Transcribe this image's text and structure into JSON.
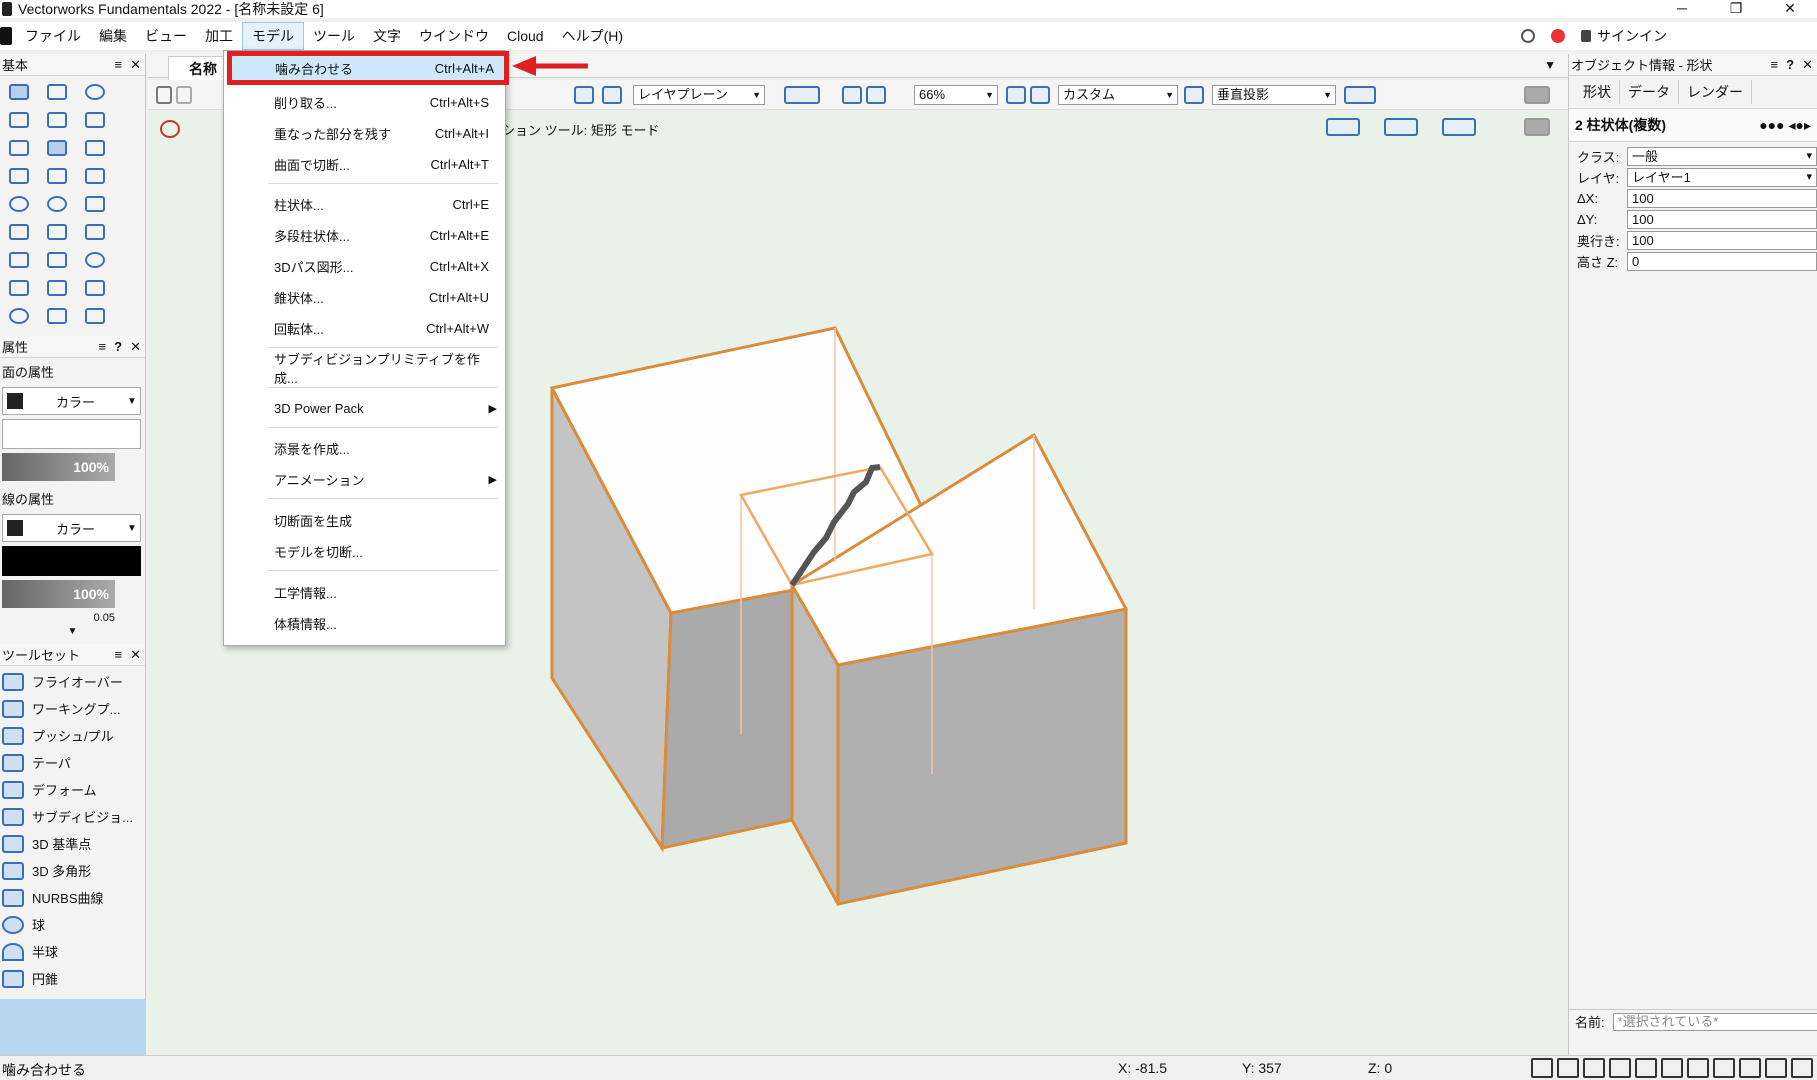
{
  "window": {
    "title": "Vectorworks Fundamentals 2022 - [名称未設定 6]",
    "buttons": [
      "─",
      "❐",
      "✕"
    ]
  },
  "menubar": {
    "items": [
      "ファイル",
      "編集",
      "ビュー",
      "加工",
      "モデル",
      "ツール",
      "文字",
      "ウインドウ",
      "Cloud",
      "ヘルプ(H)"
    ],
    "signin": "サインイン"
  },
  "left_panel": {
    "basic_title": "基本",
    "attr_title": "属性",
    "fill_label": "面の属性",
    "fill_color_label": "カラー",
    "fill_opacity": "100%",
    "line_label": "線の属性",
    "line_color_label": "カラー",
    "line_opacity": "100%",
    "line_thickness": "0.05",
    "toolset_title": "ツールセット",
    "toolset_items": [
      "フライオーバー",
      "ワーキングプ...",
      "プッシュ/プル",
      "テーパ",
      "デフォーム",
      "サブディビジョ...",
      "3D 基準点",
      "3D 多角形",
      "NURBS曲線",
      "球",
      "半球",
      "円錐"
    ]
  },
  "document": {
    "tab_label": "名称",
    "layer_select": "レイヤプレーン",
    "zoom": "66%",
    "render_mode": "カスタム",
    "projection": "垂直投影",
    "mode_text": "ション ツール: 矩形 モード"
  },
  "model_menu": {
    "items": [
      {
        "label": "噛み合わせる",
        "shortcut": "Ctrl+Alt+A"
      },
      {
        "label": "削り取る...",
        "shortcut": "Ctrl+Alt+S"
      },
      {
        "label": "重なった部分を残す",
        "shortcut": "Ctrl+Alt+I"
      },
      {
        "label": "曲面で切断...",
        "shortcut": "Ctrl+Alt+T"
      },
      {
        "label": "柱状体...",
        "shortcut": "Ctrl+E"
      },
      {
        "label": "多段柱状体...",
        "shortcut": "Ctrl+Alt+E"
      },
      {
        "label": "3Dパス図形...",
        "shortcut": "Ctrl+Alt+X"
      },
      {
        "label": "錐状体...",
        "shortcut": "Ctrl+Alt+U"
      },
      {
        "label": "回転体...",
        "shortcut": "Ctrl+Alt+W"
      },
      {
        "label": "サブディビジョンプリミティブを作成...",
        "shortcut": ""
      },
      {
        "label": "3D Power Pack",
        "shortcut": ""
      },
      {
        "label": "添景を作成...",
        "shortcut": ""
      },
      {
        "label": "アニメーション",
        "shortcut": ""
      },
      {
        "label": "切断面を生成",
        "shortcut": ""
      },
      {
        "label": "モデルを切断...",
        "shortcut": ""
      },
      {
        "label": "工学情報...",
        "shortcut": ""
      },
      {
        "label": "体積情報...",
        "shortcut": ""
      }
    ]
  },
  "obj_info": {
    "title": "オブジェクト情報 - 形状",
    "tabs": [
      "形状",
      "データ",
      "レンダー"
    ],
    "object_type": "2 柱状体(複数)",
    "fields": [
      {
        "key": "クラス:",
        "value": "一般"
      },
      {
        "key": "レイヤ:",
        "value": "レイヤー1"
      },
      {
        "key": "ΔX:",
        "value": "100"
      },
      {
        "key": "ΔY:",
        "value": "100"
      },
      {
        "key": "奥行き:",
        "value": "100"
      },
      {
        "key": "高さ Z:",
        "value": "0"
      }
    ],
    "name_label": "名前:",
    "name_value": "*選択されている*"
  },
  "status": {
    "message": "噛み合わせる",
    "x": "X: -81.5",
    "y": "Y: 357",
    "z": "Z: 0"
  },
  "colors": {
    "highlight_border": "#e02020",
    "model_edge": "#d98c3a",
    "canvas_bg": "#e8f2e8"
  }
}
